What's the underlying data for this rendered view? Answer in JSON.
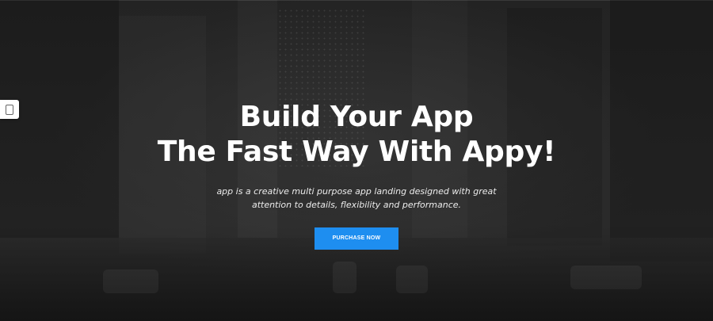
{
  "hero": {
    "title_line1": "Build Your App",
    "title_line2": "The Fast Way With Appy!",
    "subtitle_line1": "app is a creative multi purpose app landing designed with great",
    "subtitle_line2": "attention to details, flexibility and performance.",
    "cta_label": "PURCHASE NOW"
  },
  "side_tab": {
    "icon": "phone-icon"
  },
  "colors": {
    "accent": "#1e8ef0",
    "background": "#222222",
    "text": "#ffffff"
  }
}
